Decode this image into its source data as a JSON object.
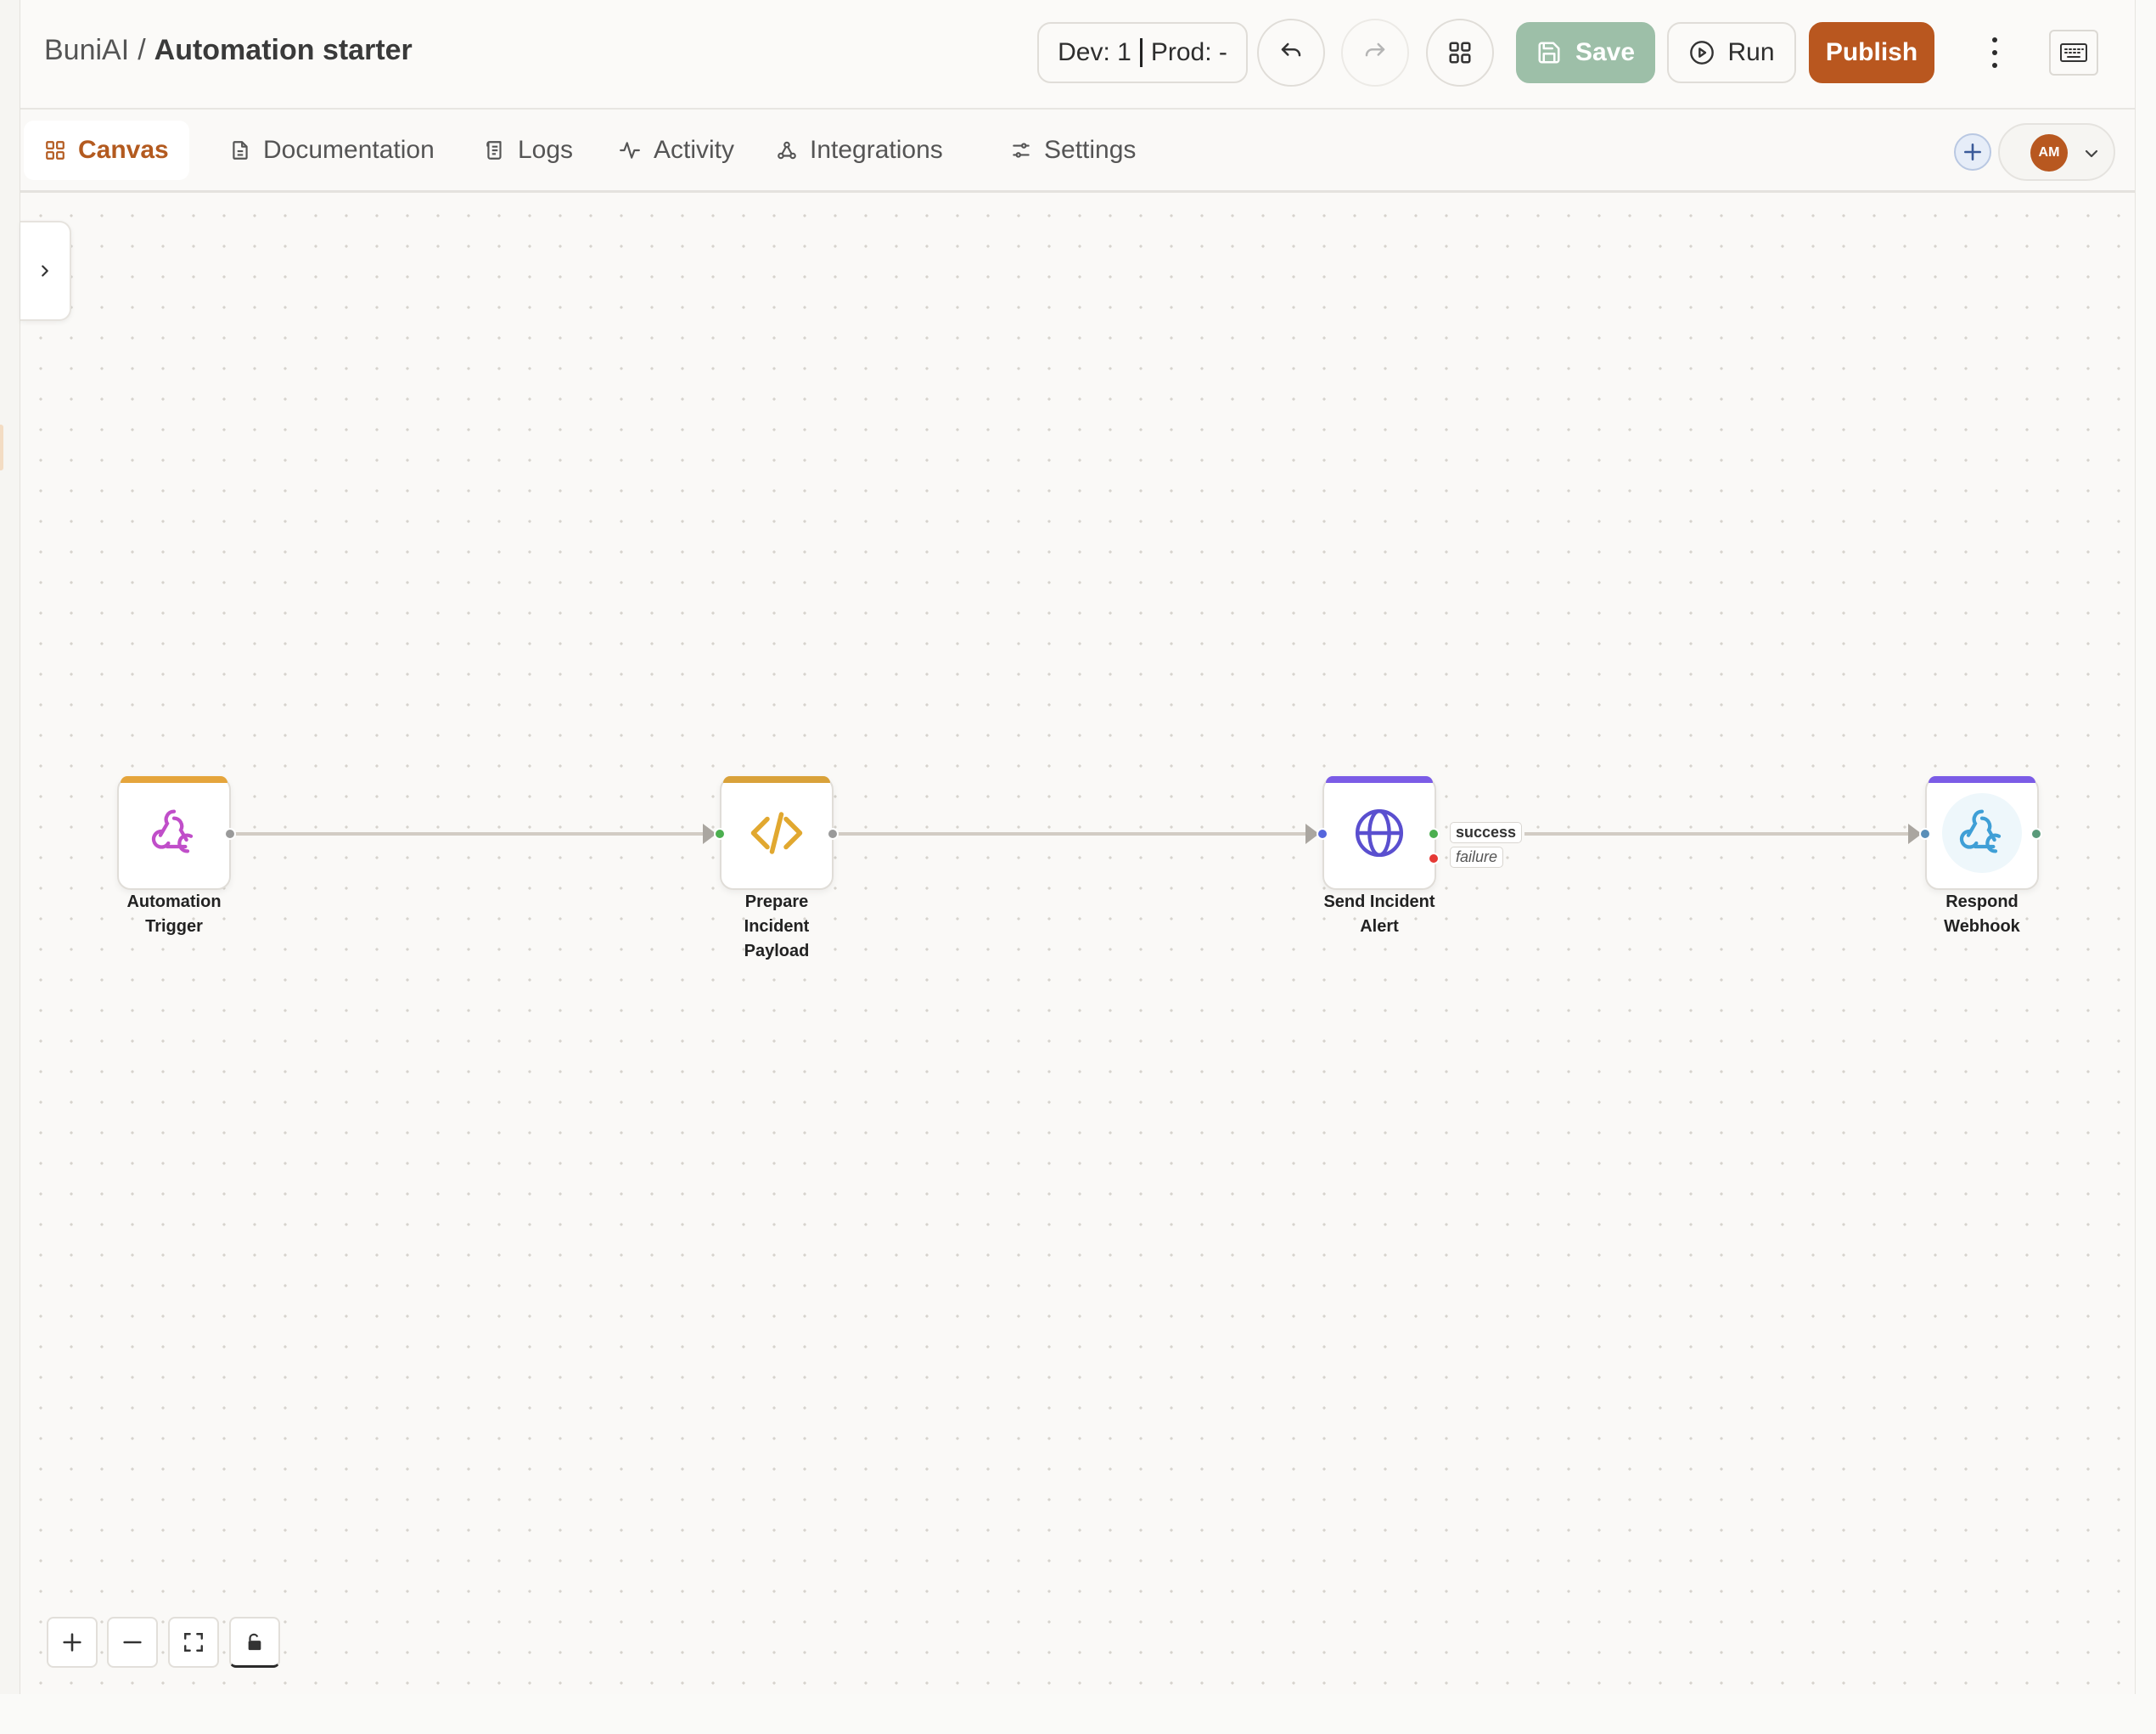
{
  "header": {
    "org": "BuniAI",
    "separator": "/",
    "project": "Automation starter",
    "env_dev": "Dev: 1",
    "env_prod": "Prod: -",
    "save_label": "Save",
    "run_label": "Run",
    "publish_label": "Publish"
  },
  "tabs": [
    {
      "label": "Canvas",
      "icon": "grid-icon",
      "active": true
    },
    {
      "label": "Documentation",
      "icon": "document-icon"
    },
    {
      "label": "Logs",
      "icon": "scroll-icon"
    },
    {
      "label": "Activity",
      "icon": "activity-icon"
    },
    {
      "label": "Integrations",
      "icon": "webhook-icon"
    },
    {
      "label": "Settings",
      "icon": "sliders-icon"
    }
  ],
  "user": {
    "initials": "AM"
  },
  "nodes": [
    {
      "id": "automation-trigger",
      "label_lines": [
        "Automation",
        "Trigger"
      ],
      "icon": "webhook-icon",
      "accent": "#e5a53c"
    },
    {
      "id": "prepare-incident-payload",
      "label_lines": [
        "Prepare",
        "Incident",
        "Payload"
      ],
      "icon": "code-icon",
      "accent": "#d9a23a"
    },
    {
      "id": "send-incident-alert",
      "label_lines": [
        "Send Incident",
        "Alert"
      ],
      "icon": "globe-icon",
      "accent": "#7b5ce6"
    },
    {
      "id": "respond-webhook",
      "label_lines": [
        "Respond",
        "Webhook"
      ],
      "icon": "webhook-icon",
      "accent": "#7b5ce6"
    }
  ],
  "branches": {
    "success": "success",
    "failure": "failure"
  },
  "colors": {
    "accent": "#b9571f",
    "save": "#9dbfa8",
    "success": "#4caf50",
    "failure": "#e53935",
    "port_blue": "#5566dd"
  }
}
